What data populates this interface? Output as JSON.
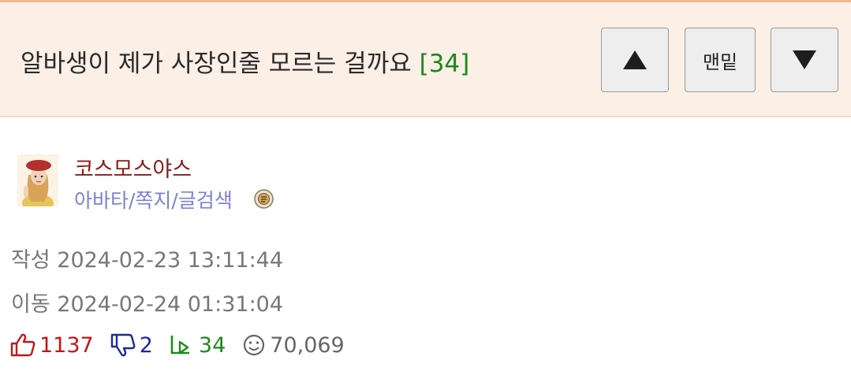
{
  "post": {
    "title": "알바생이 제가 사장인줄 모르는 걸까요",
    "comment_count": "[34]"
  },
  "nav": {
    "up_icon": "triangle-up-icon",
    "bottom_label": "맨밑",
    "down_icon": "triangle-down-icon"
  },
  "author": {
    "name": "코스모스야스",
    "links": "아바타/쪽지/글검색",
    "level_icon": "level-badge-icon"
  },
  "meta": {
    "created": "작성 2024-02-23 13:11:44",
    "moved": "이동 2024-02-24 01:31:04"
  },
  "stats": {
    "likes": "1137",
    "dislikes": "2",
    "replies": "34",
    "views": "70,069"
  },
  "colors": {
    "header_bg": "#fbefe6",
    "title_count": "#1a8a1a",
    "author_name": "#8b1a1a",
    "author_links": "#7f7fd6",
    "likes": "#c01818",
    "dislikes": "#1c2a9c",
    "replies": "#1d8a1d",
    "views": "#666666"
  }
}
